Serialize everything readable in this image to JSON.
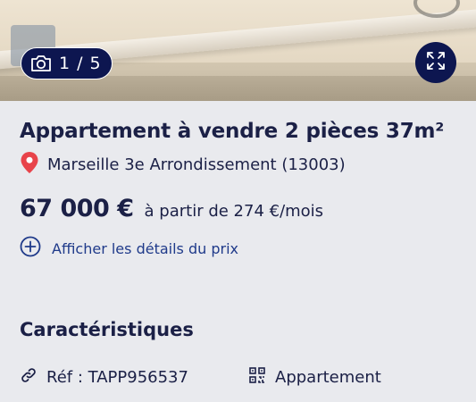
{
  "gallery": {
    "counter_current": "1",
    "counter_sep": "/",
    "counter_total": "5",
    "camera_icon": "camera-icon",
    "expand_icon": "expand-arrows-icon"
  },
  "listing": {
    "title": "Appartement à vendre 2 pièces 37m²",
    "location": "Marseille 3e Arrondissement (13003)",
    "location_icon": "map-pin-icon",
    "price": "67 000 €",
    "monthly": "à partir de 274 €/mois",
    "price_details_link": "Afficher les détails du prix",
    "price_details_icon": "plus-circle-icon"
  },
  "characteristics": {
    "title": "Caractéristiques",
    "reference": "Réf : TAPP956537",
    "reference_icon": "link-icon",
    "property_type": "Appartement",
    "property_type_icon": "qr-code-icon"
  },
  "colors": {
    "navy": "#0d1650",
    "text": "#1b2046",
    "link": "#1f3a8a",
    "pin": "#e8434a",
    "background": "#e9eaee"
  }
}
